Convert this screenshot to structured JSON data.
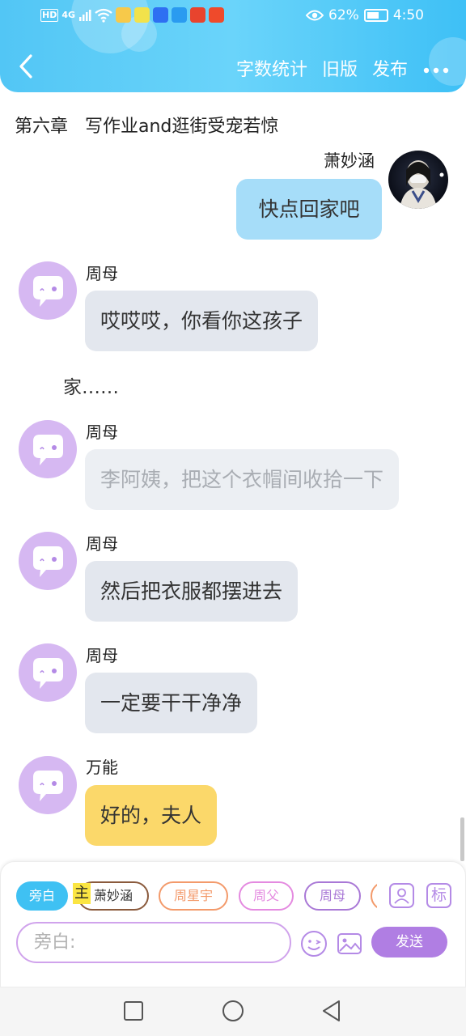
{
  "status_bar": {
    "left_badges": [
      "HD",
      "4G"
    ],
    "battery_percent": "62%",
    "time": "4:50",
    "colors": {
      "app_icons": [
        "#f7c94a",
        "#f2e24b",
        "#2e6ff2",
        "#2a9bf0",
        "#e8442e",
        "#ef4a2b"
      ]
    }
  },
  "header": {
    "back_icon": "chevron-left-icon",
    "actions": [
      "字数统计",
      "旧版",
      "发布"
    ],
    "more_icon": "more-dots-icon",
    "colors": {
      "gradient_start": "#52c6f5",
      "gradient_end": "#3ec0f6"
    }
  },
  "chapter_title": "第六章   写作业and逛街受宠若惊",
  "chat": {
    "right_message": {
      "name": "萧妙涵",
      "text": "快点回家吧"
    },
    "messages": [
      {
        "name": "周母",
        "text": "哎哎哎，你看你这孩子",
        "style": "normal"
      },
      {
        "name": "周母",
        "text": "李阿姨，把这个衣帽间收拾一下",
        "style": "faded"
      },
      {
        "name": "周母",
        "text": "然后把衣服都摆进去",
        "style": "normal"
      },
      {
        "name": "周母",
        "text": "一定要干干净净",
        "style": "normal"
      },
      {
        "name": "万能",
        "text": "好的，夫人",
        "style": "yellow"
      }
    ],
    "narration": "家……"
  },
  "composer": {
    "roles": [
      {
        "label": "旁白",
        "active": true,
        "color": "#3fc1f3"
      },
      {
        "label": "萧妙涵",
        "active": false,
        "color": "#8a5a3c"
      },
      {
        "label": "周星宇",
        "active": false,
        "color": "#f39a6b"
      },
      {
        "label": "周父",
        "active": false,
        "color": "#e48ae0"
      },
      {
        "label": "周母",
        "active": false,
        "color": "#a978d6"
      }
    ],
    "main_marker": "主",
    "tag_button": "标",
    "input_placeholder": "旁白:",
    "send_label": "发送",
    "colors": {
      "accent": "#b07ee3",
      "input_border": "#d0a3ec"
    }
  }
}
